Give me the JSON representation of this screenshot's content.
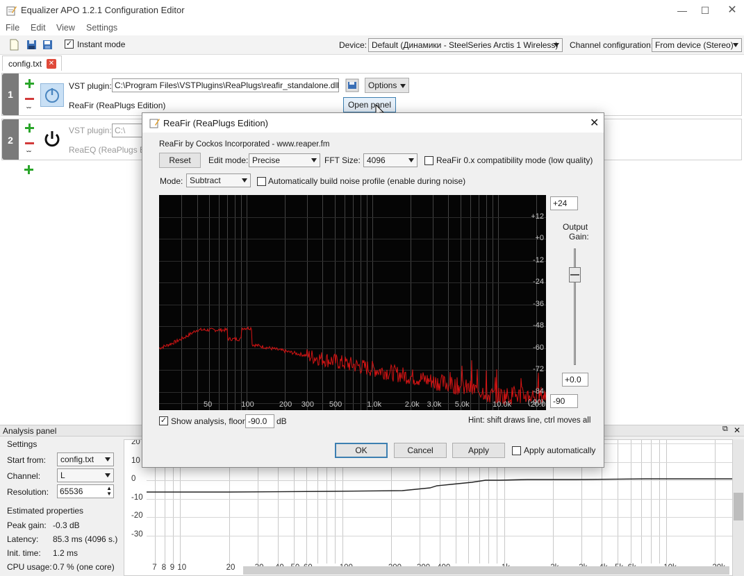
{
  "window": {
    "title": "Equalizer APO 1.2.1 Configuration Editor"
  },
  "menu": [
    "File",
    "Edit",
    "View",
    "Settings"
  ],
  "toolbar": {
    "instant_mode": "Instant mode",
    "device_label": "Device:",
    "device_value": "Default (Динамики - SteelSeries Arctis 1 Wireless)",
    "channel_label": "Channel configuration:",
    "channel_value": "From device (Stereo)"
  },
  "tab": {
    "label": "config.txt"
  },
  "filters": [
    {
      "num": "1",
      "vst_label": "VST plugin:",
      "path": "C:\\Program Files\\VSTPlugins\\ReaPlugs\\reafir_standalone.dll",
      "options": "Options",
      "name": "ReaFir (ReaPlugs Edition)",
      "open_panel": "Open panel"
    },
    {
      "num": "2",
      "vst_label": "VST plugin:",
      "path": "C:\\",
      "name": "ReaEQ (ReaPlugs Ed"
    }
  ],
  "dialog": {
    "title": "ReaFir (ReaPlugs Edition)",
    "credit": "ReaFir by Cockos Incorporated - www.reaper.fm",
    "reset": "Reset",
    "edit_mode_label": "Edit mode:",
    "edit_mode_value": "Precise",
    "fft_label": "FFT Size:",
    "fft_value": "4096",
    "compat_label": "ReaFir 0.x compatibility mode (low quality)",
    "mode_label": "Mode:",
    "mode_value": "Subtract",
    "auto_noise_label": "Automatically build noise profile (enable during noise)",
    "top_gain": "+24",
    "output_gain_label_1": "Output",
    "output_gain_label_2": "Gain:",
    "gain_value": "+0.0",
    "floor_box": "-90",
    "db_ticks": [
      "+12",
      "+0",
      "-12",
      "-24",
      "-36",
      "-48",
      "-60",
      "-72",
      "-84",
      "(-90)"
    ],
    "freq_ticks": [
      "50",
      "100",
      "200",
      "300",
      "500",
      "1.0k",
      "2.0k",
      "3.0k",
      "5.0k",
      "10.0k",
      "20.0k"
    ],
    "show_analysis_label": "Show analysis, floor:",
    "floor_value": "-90.0",
    "db_unit": "dB",
    "hint": "Hint: shift draws line, ctrl moves all",
    "ok": "OK",
    "cancel": "Cancel",
    "apply": "Apply",
    "apply_auto": "Apply automatically",
    "colors": {
      "spectrum": "#d41414",
      "plot_bg": "#050505"
    }
  },
  "analysis": {
    "title": "Analysis panel",
    "settings": "Settings",
    "start_from_label": "Start from:",
    "start_from_value": "config.txt",
    "channel_label": "Channel:",
    "channel_value": "L",
    "resolution_label": "Resolution:",
    "resolution_value": "65536",
    "estimated": "Estimated properties",
    "peak_gain_label": "Peak gain:",
    "peak_gain_value": "-0.3 dB",
    "latency_label": "Latency:",
    "latency_value": "85.3 ms (4096 s.)",
    "init_label": "Init. time:",
    "init_value": "1.2 ms",
    "cpu_label": "CPU usage:",
    "cpu_value": "0.7 % (one core)",
    "y_ticks": [
      "20",
      "10",
      "0",
      "-10",
      "-20",
      "-30"
    ],
    "x_ticks": [
      "7",
      "8",
      "9",
      "10",
      "20",
      "30",
      "40",
      "50",
      "60",
      "100",
      "200",
      "300",
      "400",
      "1k",
      "2k",
      "3k",
      "4k",
      "5k",
      "6k",
      "10k",
      "20k"
    ]
  }
}
